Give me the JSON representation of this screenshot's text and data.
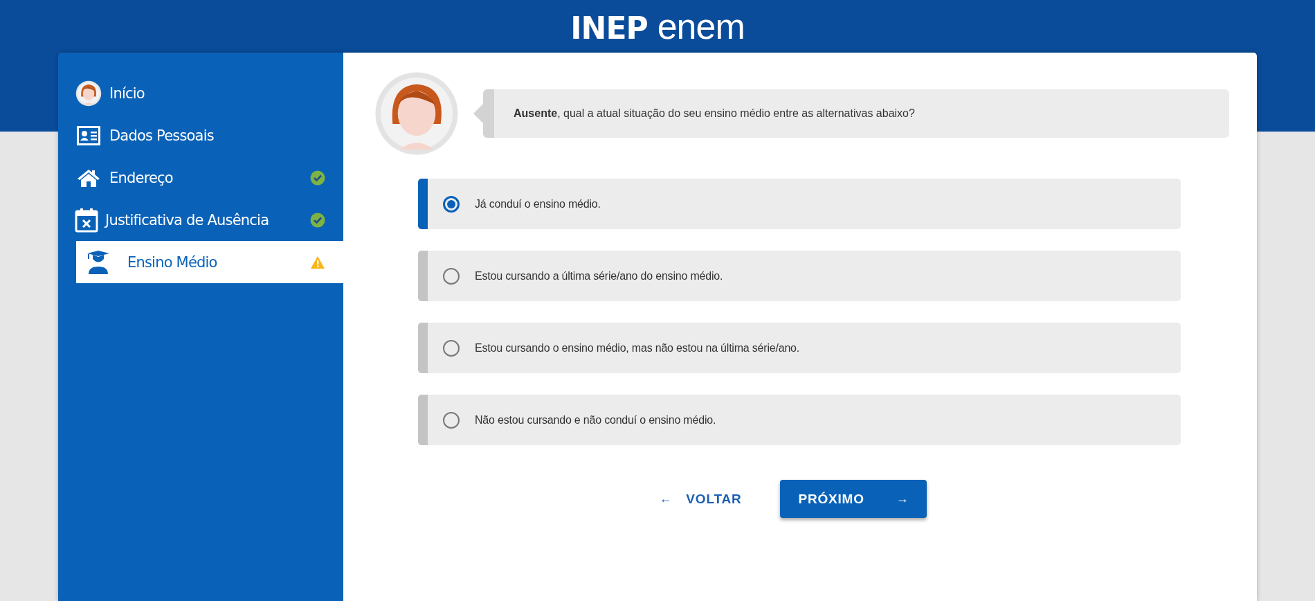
{
  "header": {
    "logo": {
      "left": "INEP",
      "right": "enem"
    }
  },
  "sidebar": {
    "items": [
      {
        "label": "Início",
        "selected": false,
        "complete": false,
        "warning": false
      },
      {
        "label": "Dados Pessoais",
        "selected": false,
        "complete": false,
        "warning": false
      },
      {
        "label": "Endereço",
        "selected": false,
        "complete": true,
        "warning": false
      },
      {
        "label": "Justificativa de Ausência",
        "selected": false,
        "complete": true,
        "warning": false
      },
      {
        "label": "Ensino Médio",
        "selected": true,
        "complete": false,
        "warning": true
      }
    ]
  },
  "question": {
    "text": "**Ausente**, qual a atual situação do seu ensino médio entre as alternativas abaixo?"
  },
  "options": [
    {
      "label": "Já conduí o ensino médio.",
      "selected": true
    },
    {
      "label": "Estou cursando a última série/ano do ensino médio.",
      "selected": false
    },
    {
      "label": "Estou cursando o ensino médio, mas não estou na última série/ano.",
      "selected": false
    },
    {
      "label": "Não estou cursando e não conduí o ensino médio.",
      "selected": false
    }
  ],
  "buttons": {
    "back": {
      "label": "VOLTAR",
      "arrow": "←"
    },
    "next": {
      "label": "PRÓXIMO",
      "arrow": "→"
    }
  }
}
